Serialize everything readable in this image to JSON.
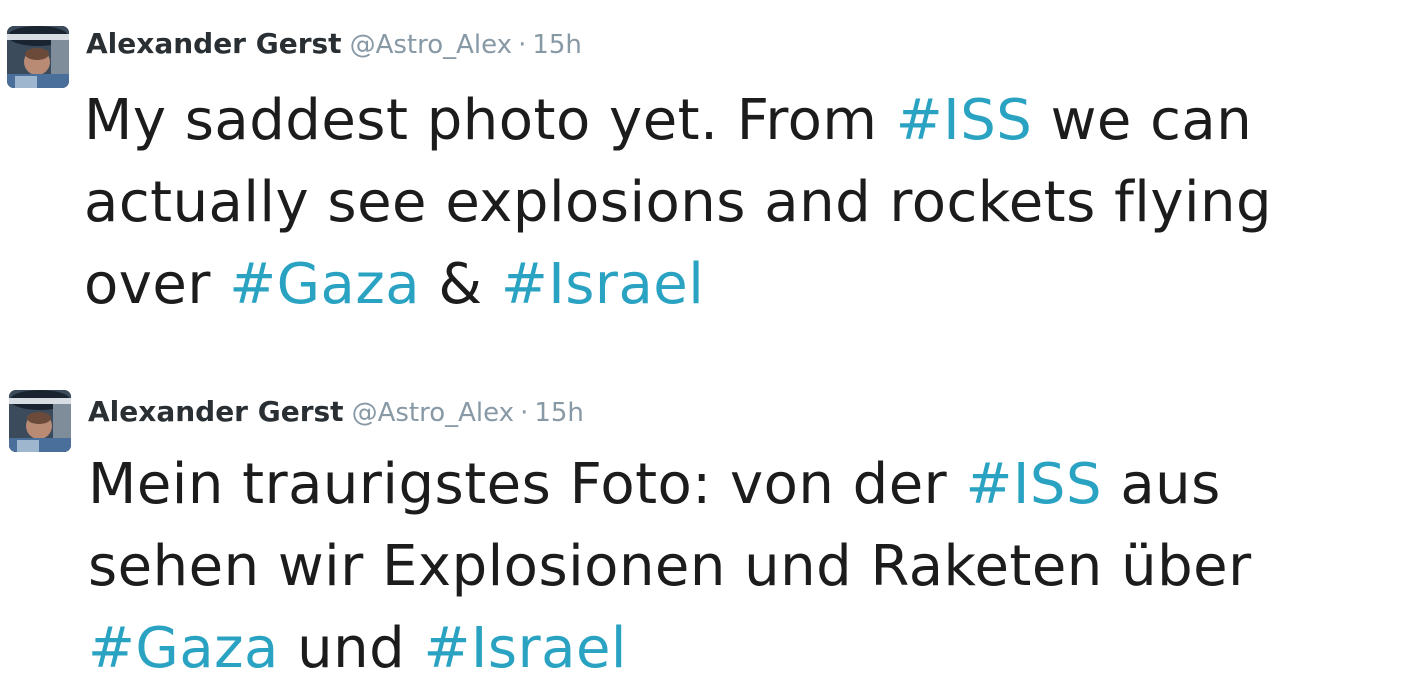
{
  "colors": {
    "hashtag": "#2aa3c2",
    "name": "#292f33",
    "meta": "#8899a6",
    "text": "#1c1c1c"
  },
  "tweets": [
    {
      "author": {
        "name": "Alexander Gerst",
        "handle": "@Astro_Alex",
        "avatar_icon": "avatar-photo"
      },
      "separator": "·",
      "time": "15h",
      "line1": {
        "a": "My saddest photo yet. From ",
        "tag": "#ISS",
        "b": " we can"
      },
      "line2": "actually see explosions and rockets flying",
      "line3": {
        "a": "over ",
        "tag1": "#Gaza",
        "mid": " & ",
        "tag2": "#Israel"
      }
    },
    {
      "author": {
        "name": "Alexander Gerst",
        "handle": "@Astro_Alex",
        "avatar_icon": "avatar-photo"
      },
      "separator": "·",
      "time": "15h",
      "line1": {
        "a": "Mein traurigstes Foto: von der ",
        "tag": "#ISS",
        "b": " aus"
      },
      "line2": "sehen wir Explosionen und Raketen über",
      "line3": {
        "a": "",
        "tag1": "#Gaza",
        "mid": " und ",
        "tag2": "#Israel"
      }
    }
  ]
}
